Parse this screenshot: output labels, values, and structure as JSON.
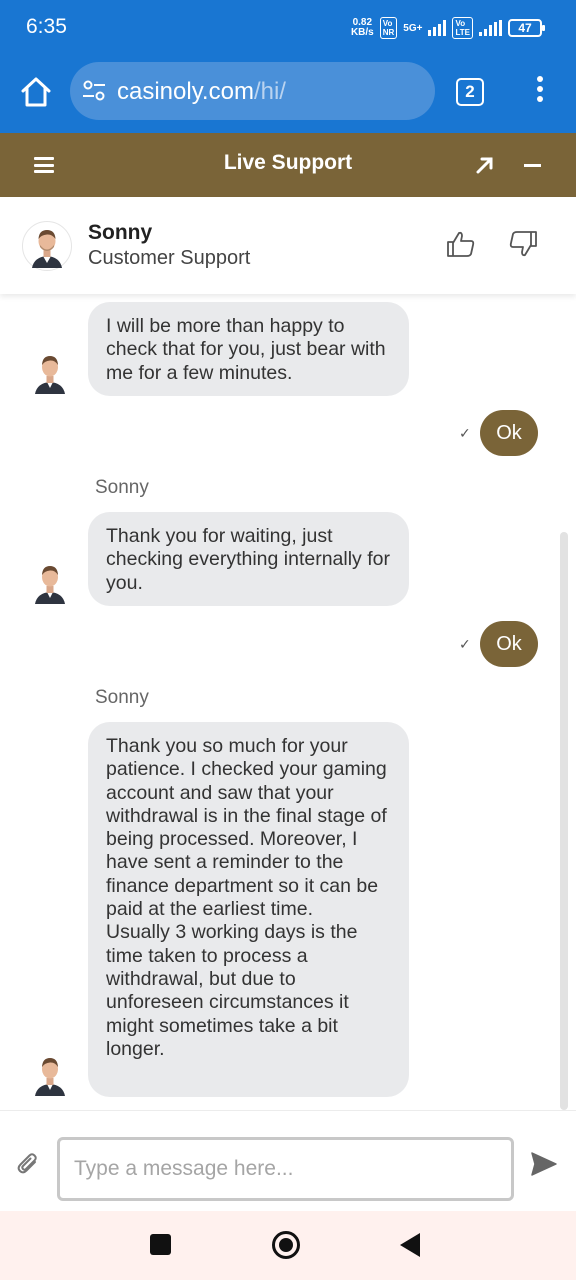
{
  "status_bar": {
    "time": "6:35",
    "net_speed": "0.82",
    "net_speed_unit": "KB/s",
    "sim1_tag": "Vo NR",
    "network": "5G+",
    "sim2_tag": "Vo LTE",
    "battery": "47"
  },
  "browser": {
    "url_host": "casinoly.com",
    "url_path": "/hi/",
    "tab_count": "2"
  },
  "live_support": {
    "title": "Live Support"
  },
  "agent": {
    "name": "Sonny",
    "role": "Customer Support"
  },
  "messages": [
    {
      "from": "agent",
      "sender": "",
      "text": "I will be more than happy to check that for you, just bear with me for a few minutes."
    },
    {
      "from": "user",
      "text": "Ok",
      "status": "✓"
    },
    {
      "from": "agent",
      "sender": "Sonny",
      "text": "Thank you for waiting, just checking everything internally for you."
    },
    {
      "from": "user",
      "text": "Ok",
      "status": "✓"
    },
    {
      "from": "agent",
      "sender": "Sonny",
      "text": "Thank you so much for your patience. I checked your gaming account and saw that your withdrawal is in the final stage of being processed. Moreover, I have sent a reminder to the finance department so it can be paid at the earliest time.\nUsually 3 working days is the time taken to process a withdrawal, but due to unforeseen circumstances it might sometimes take a bit longer."
    }
  ],
  "composer": {
    "placeholder": "Type a message here..."
  },
  "colors": {
    "browser_blue": "#1976d2",
    "brand_brown": "#7a6438",
    "bubble_gray": "#e9eaec"
  }
}
